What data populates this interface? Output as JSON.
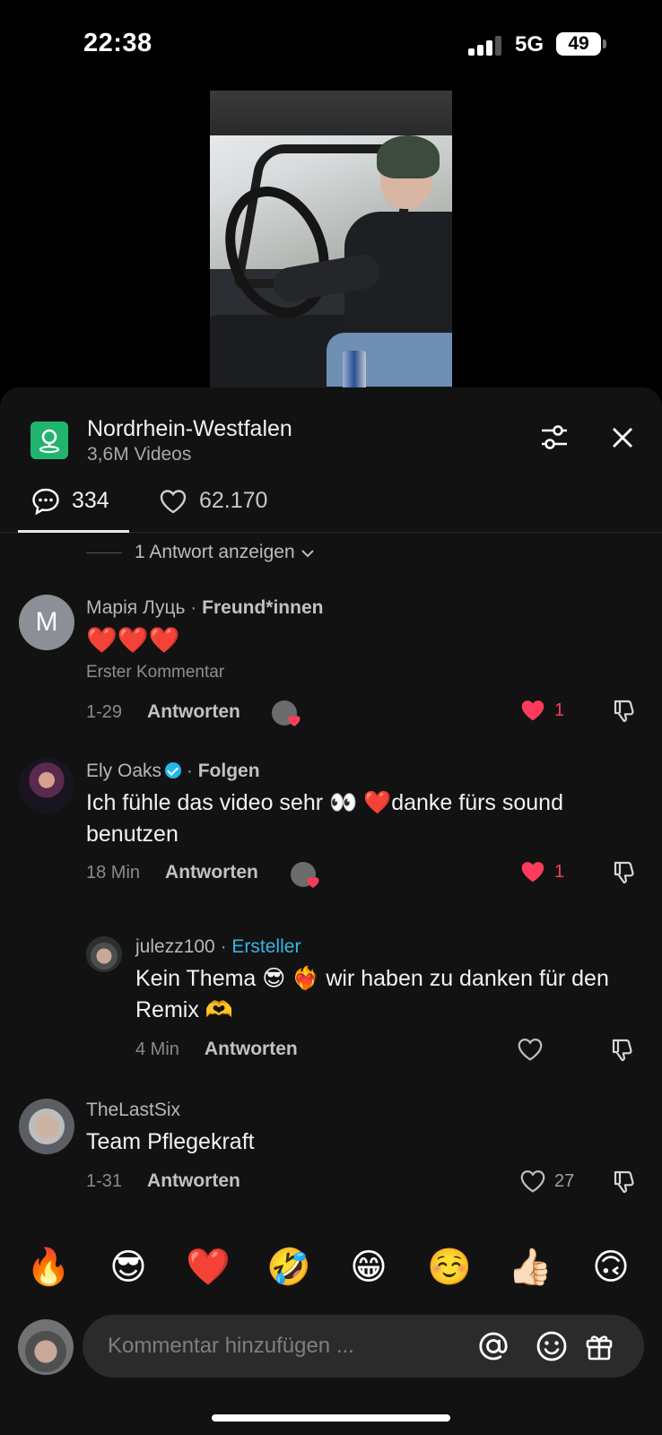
{
  "status_bar": {
    "time": "22:38",
    "network": "5G",
    "battery": "49"
  },
  "header": {
    "location_name": "Nordrhein-Westfalen",
    "location_videos": "3,6M Videos"
  },
  "tabs": {
    "comments_count": "334",
    "likes_count": "62.170"
  },
  "show_replies_label": "1 Antwort anzeigen",
  "comments": [
    {
      "avatar_letter": "M",
      "author": "Марія Луць",
      "tag": "Freund*innen",
      "text": "❤️❤️❤️",
      "note": "Erster Kommentar",
      "time": "1-29",
      "reply_label": "Antworten",
      "likes": "1"
    },
    {
      "author": "Ely Oaks",
      "tag": "Folgen",
      "text": "Ich fühle das video sehr 👀 ❤️danke fürs sound benutzen",
      "time": "18 Min",
      "reply_label": "Antworten",
      "likes": "1"
    },
    {
      "author": "julezz100",
      "tag": "Ersteller",
      "text": "Kein Thema 😎 ❤️‍🔥 wir haben zu danken für den Remix 🫶",
      "time": "4 Min",
      "reply_label": "Antworten"
    },
    {
      "author": "TheLastSix",
      "text": "Team Pflegekraft",
      "time": "1-31",
      "reply_label": "Antworten",
      "likes": "27"
    }
  ],
  "separator": "·",
  "emoji_bar": [
    "🔥",
    "😎",
    "❤️",
    "🤣",
    "😁",
    "☺️",
    "👍🏻",
    "🙃"
  ],
  "composer": {
    "placeholder": "Kommentar hinzufügen ..."
  },
  "colors": {
    "accent_like": "#ff3b5c",
    "creator_tag": "#35b6e6",
    "location_icon": "#21b46f"
  }
}
